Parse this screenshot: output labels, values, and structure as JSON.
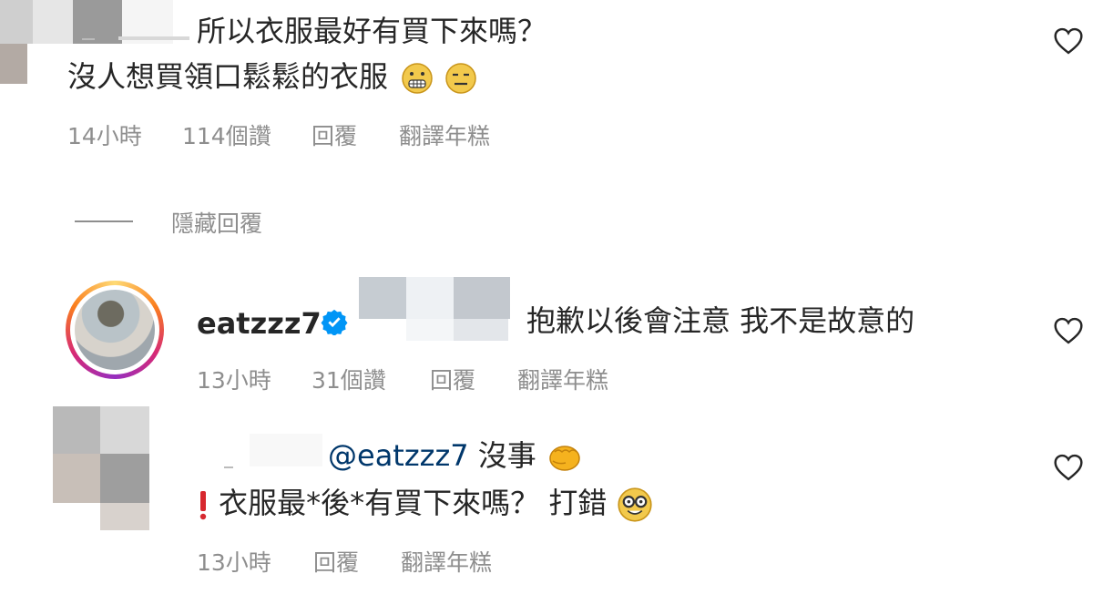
{
  "comment1": {
    "line1": "所以衣服最好有買下來嗎？",
    "line2": "沒人想買領口鬆鬆的衣服",
    "time": "14小時",
    "likes": "114個讚",
    "reply": "回覆",
    "translate": "翻譯年糕"
  },
  "hide_replies": "隱藏回覆",
  "comment2": {
    "username": "eatzzz7",
    "text": "抱歉以後會注意 我不是故意的",
    "time": "13小時",
    "likes": "31個讚",
    "reply": "回覆",
    "translate": "翻譯年糕"
  },
  "comment3": {
    "mention": "@eatzzz7",
    "line1_rest": "沒事",
    "line2": "衣服最*後*有買下來嗎？ 打錯",
    "time": "13小時",
    "reply": "回覆",
    "translate": "翻譯年糕"
  },
  "icons": [
    "heart-icon",
    "grimace-emoji",
    "expressionless-emoji",
    "verified-badge-icon",
    "fist-emoji",
    "exclamation-emoji",
    "nerd-emoji"
  ],
  "colors": {
    "text": "#262626",
    "meta": "#8e8e8e",
    "mention": "#00376b",
    "verified": "#0095f6"
  }
}
